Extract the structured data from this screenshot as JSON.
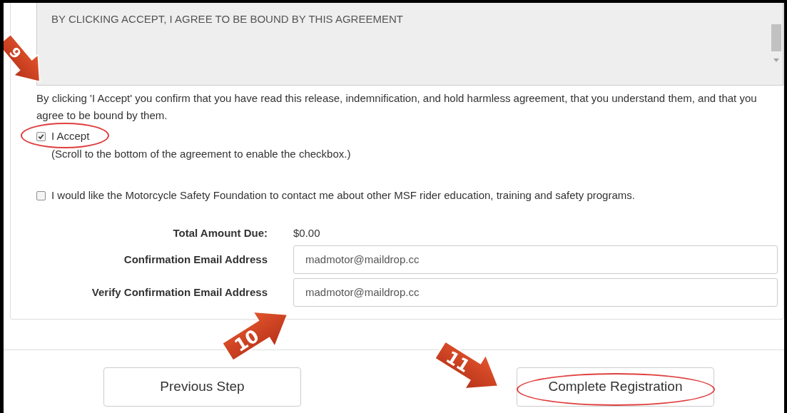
{
  "agreement_box": {
    "text": "BY CLICKING ACCEPT, I AGREE TO BE BOUND BY THIS AGREEMENT"
  },
  "confirmation_text": "By clicking 'I Accept' you confirm that you have read this release, indemnification, and hold harmless agreement, that you understand them, and that you agree to be bound by them.",
  "checkboxes": [
    {
      "label": "I Accept",
      "hint": "(Scroll to the bottom of the agreement to enable the checkbox.)",
      "checked": true,
      "highlighted": true
    },
    {
      "label": "I would like the Motorcycle Safety Foundation to contact me about other MSF rider education, training and safety programs.",
      "checked": false,
      "highlighted": false
    }
  ],
  "summary": [
    {
      "kind": "text",
      "label": "Total Amount Due:",
      "value": "$0.00"
    },
    {
      "kind": "field",
      "label": "Confirmation Email Address",
      "value": "madmotor@maildrop.cc"
    },
    {
      "kind": "field",
      "label": "Verify Confirmation Email Address",
      "value": "madmotor@maildrop.cc"
    }
  ],
  "buttons": [
    {
      "label": "Previous Step",
      "highlighted": false
    },
    {
      "label": "Complete Registration",
      "highlighted": true
    }
  ],
  "callouts": [
    {
      "number": "9"
    },
    {
      "number": "10"
    },
    {
      "number": "11"
    }
  ]
}
